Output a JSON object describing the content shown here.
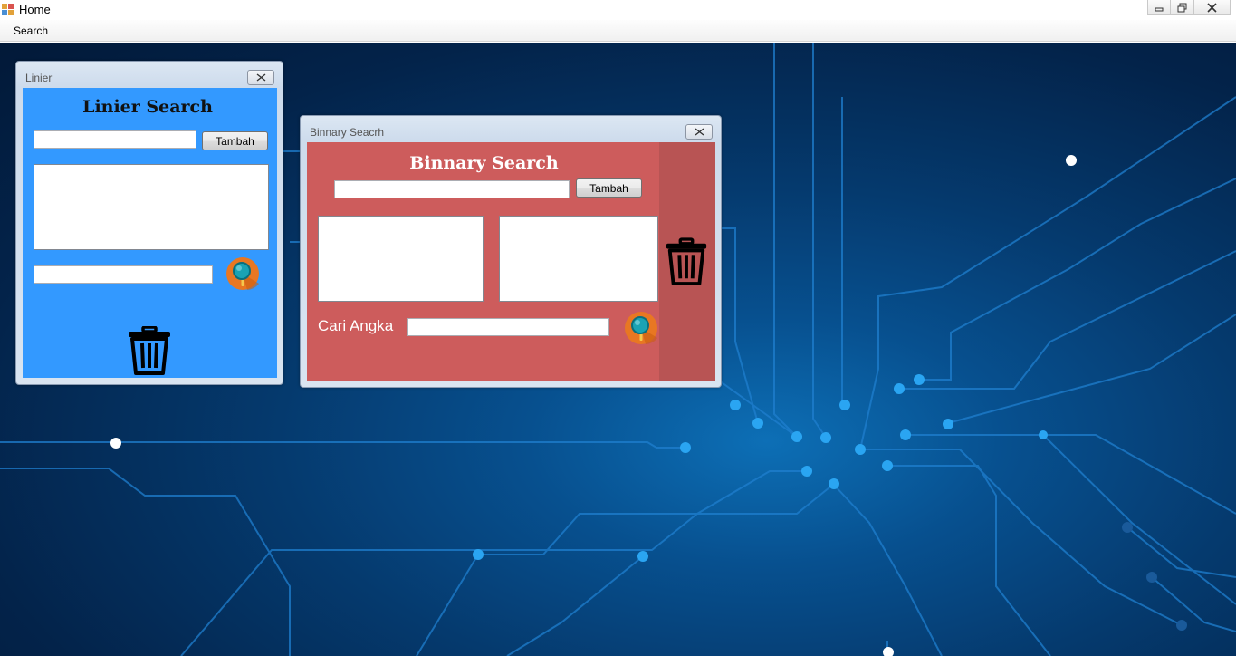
{
  "window": {
    "title": "Home",
    "app_icon": "app-grid-icon",
    "controls": [
      "minimize-icon",
      "restore-icon",
      "close-icon"
    ]
  },
  "menu": {
    "items": [
      {
        "label": "Search"
      }
    ]
  },
  "linier": {
    "title": "Linier",
    "heading": "Linier Search",
    "input_value": "",
    "add_button": "Tambah",
    "search_input_value": "",
    "search_icon": "search-magnifier-icon",
    "delete_icon": "trash-icon",
    "bg_color": "#3399ff"
  },
  "binary": {
    "title": "Binnary Seacrh",
    "heading": "Binnary Search",
    "input_value": "",
    "add_button": "Tambah",
    "search_label": "Cari Angka",
    "search_input_value": "",
    "search_icon": "search-magnifier-icon",
    "delete_icon": "trash-icon",
    "bg_color": "#cd5c5c",
    "side_panel_color": "#b85454"
  },
  "colors": {
    "accent_orange": "#e87722",
    "search_teal": "#1aa3b3",
    "desktop_blue": "#0a5aa0"
  }
}
